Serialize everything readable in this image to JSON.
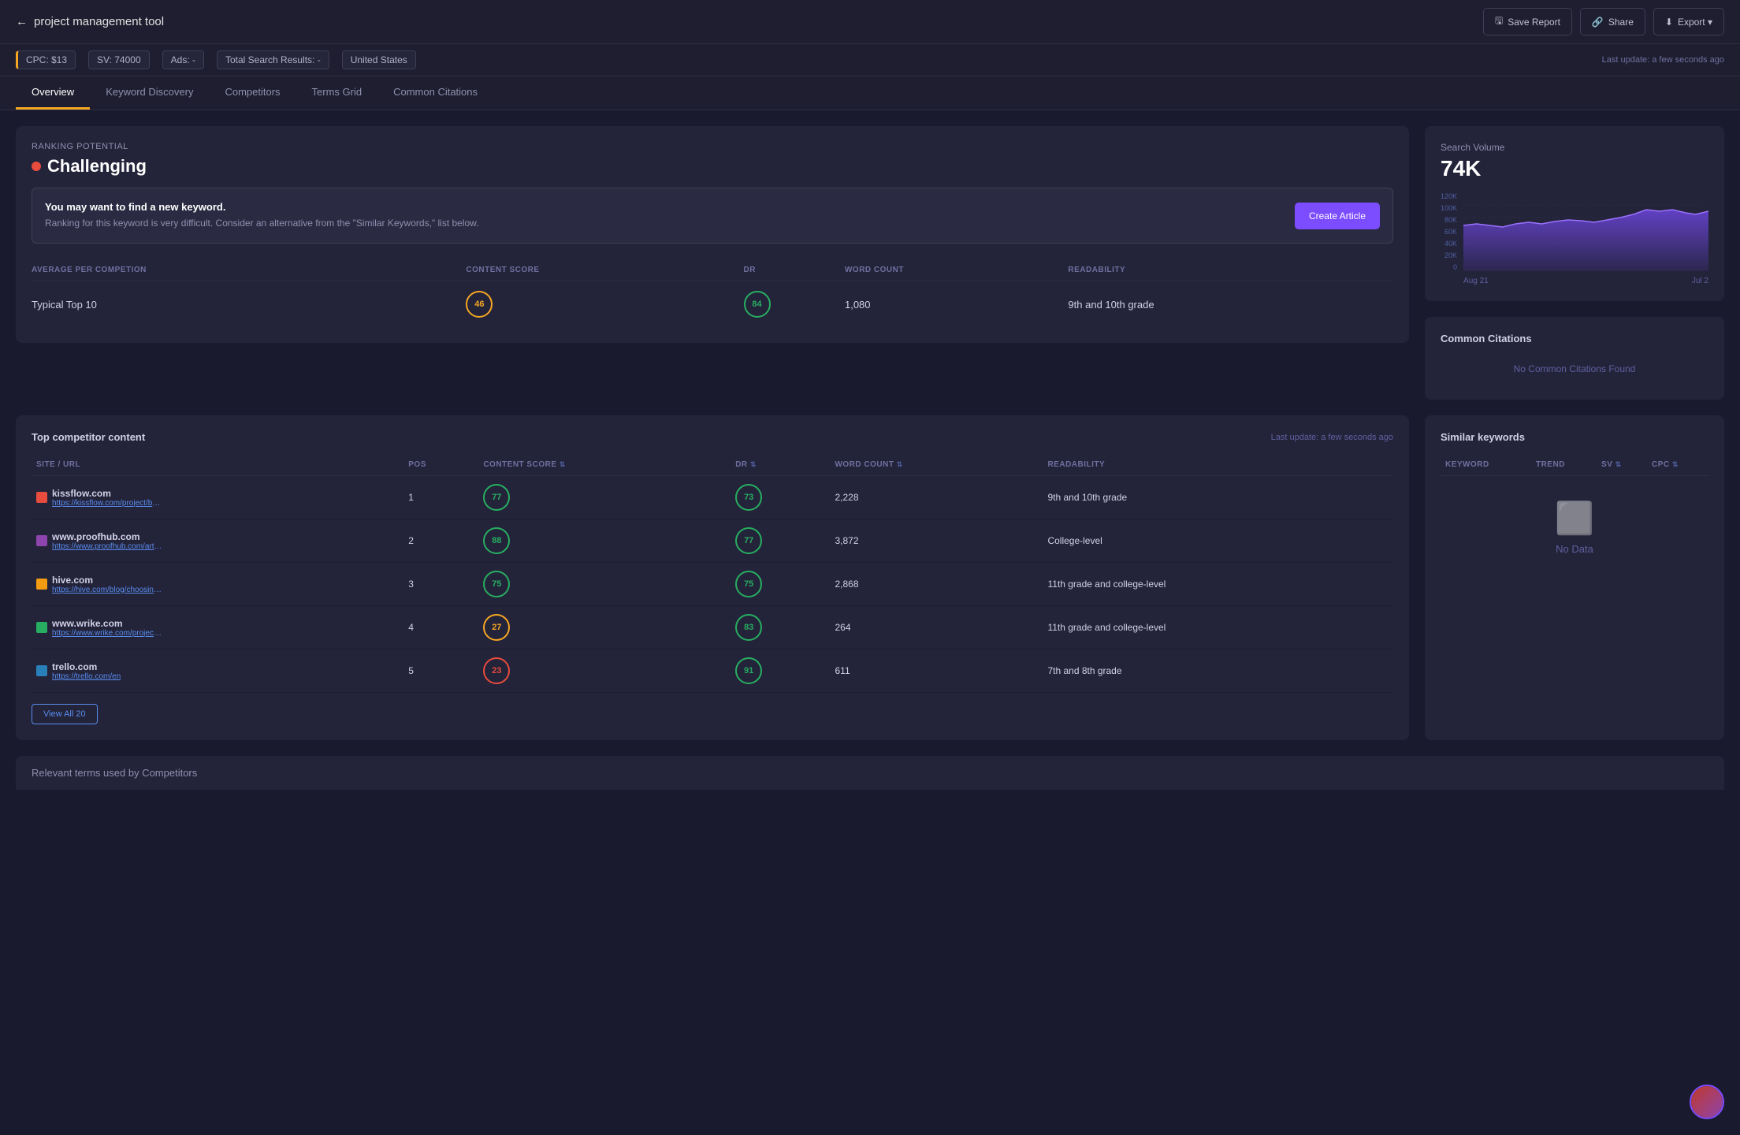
{
  "header": {
    "back_label": "project management tool",
    "back_icon": "←",
    "actions": [
      {
        "id": "save-report",
        "label": "Save Report",
        "icon": "🖫"
      },
      {
        "id": "share",
        "label": "Share",
        "icon": "🔗"
      },
      {
        "id": "export",
        "label": "Export ▾",
        "icon": "⬇"
      }
    ]
  },
  "meta": {
    "cpc": "CPC: $13",
    "sv": "SV: 74000",
    "ads": "Ads: -",
    "total_search": "Total Search Results: -",
    "region": "United States",
    "last_update": "Last update: a few seconds ago"
  },
  "tabs": [
    {
      "id": "overview",
      "label": "Overview",
      "active": true
    },
    {
      "id": "keyword-discovery",
      "label": "Keyword Discovery",
      "active": false
    },
    {
      "id": "competitors",
      "label": "Competitors",
      "active": false
    },
    {
      "id": "terms-grid",
      "label": "Terms Grid",
      "active": false
    },
    {
      "id": "common-citations",
      "label": "Common Citations",
      "active": false
    }
  ],
  "ranking_potential": {
    "label": "Ranking Potential",
    "value": "Challenging",
    "alert_title": "You may want to find a new keyword.",
    "alert_body": "Ranking for this keyword is very difficult. Consider an alternative from the \"Similar Keywords,\" list below.",
    "create_btn": "Create Article"
  },
  "stats": {
    "headers": [
      "AVERAGE PER COMPETION",
      "CONTENT SCORE",
      "DR",
      "WORD COUNT",
      "READABILITY"
    ],
    "row_label": "Typical Top 10",
    "content_score": "46",
    "dr": "84",
    "word_count": "1,080",
    "readability": "9th and 10th grade"
  },
  "search_volume": {
    "label": "Search Volume",
    "value": "74K",
    "chart_y_labels": [
      "120K",
      "100K",
      "80K",
      "60K",
      "40K",
      "20K",
      "0"
    ],
    "chart_x_labels": [
      "Aug 21",
      "Jul 2"
    ],
    "chart_data": [
      0.58,
      0.6,
      0.58,
      0.56,
      0.6,
      0.62,
      0.6,
      0.63,
      0.65,
      0.64,
      0.62,
      0.65,
      0.68,
      0.72,
      0.78,
      0.82,
      0.8,
      0.82,
      0.78,
      0.76
    ]
  },
  "common_citations": {
    "title": "Common Citations",
    "no_data": "No Common Citations Found"
  },
  "top_competitors": {
    "title": "Top competitor content",
    "last_update": "Last update: a few seconds ago",
    "columns": [
      "SITE / URL",
      "POS",
      "CONTENT SCORE",
      "DR",
      "WORD COUNT",
      "READABILITY"
    ],
    "rows": [
      {
        "site": "kissflow.com",
        "url": "https://kissflow.com/project/best-project-...",
        "pos": 1,
        "content_score": "77",
        "content_score_class": "score-77",
        "dr": "73",
        "dr_class": "score-73",
        "word_count": "2,228",
        "readability": "9th and 10th grade",
        "favicon_color": "#e74c3c"
      },
      {
        "site": "www.proofhub.com",
        "url": "https://www.proofhub.com/articles/top-pr...",
        "pos": 2,
        "content_score": "88",
        "content_score_class": "score-88",
        "dr": "77",
        "dr_class": "score-77g",
        "word_count": "3,872",
        "readability": "College-level",
        "favicon_color": "#8e44ad"
      },
      {
        "site": "hive.com",
        "url": "https://hive.com/blog/choosing-project-m...",
        "pos": 3,
        "content_score": "75",
        "content_score_class": "score-75",
        "dr": "75",
        "dr_class": "score-75g",
        "word_count": "2,868",
        "readability": "11th grade and college-level",
        "favicon_color": "#f39c12"
      },
      {
        "site": "www.wrike.com",
        "url": "https://www.wrike.com/project-managem...",
        "pos": 4,
        "content_score": "27",
        "content_score_class": "score-27",
        "dr": "83",
        "dr_class": "score-83",
        "word_count": "264",
        "readability": "11th grade and college-level",
        "favicon_color": "#27ae60"
      },
      {
        "site": "trello.com",
        "url": "https://trello.com/en",
        "pos": 5,
        "content_score": "23",
        "content_score_class": "score-23",
        "dr": "91",
        "dr_class": "score-91",
        "word_count": "611",
        "readability": "7th and 8th grade",
        "favicon_color": "#2980b9"
      }
    ],
    "view_all_label": "View All 20"
  },
  "similar_keywords": {
    "title": "Similar keywords",
    "columns": [
      "KEYWORD",
      "TREND",
      "SV",
      "CPC"
    ],
    "no_data": "No Data"
  },
  "relevant_terms": {
    "title": "Relevant terms used by Competitors"
  }
}
